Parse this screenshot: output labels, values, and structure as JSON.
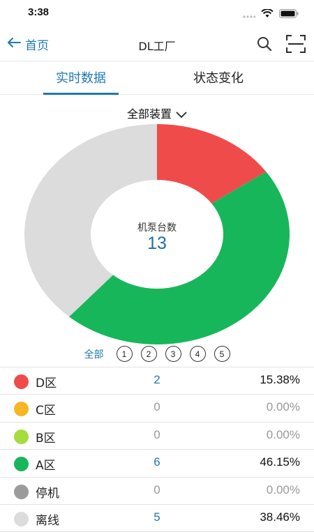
{
  "status_bar": {
    "time": "3:38"
  },
  "nav": {
    "back_label": "首页",
    "title": "DL工厂"
  },
  "tabs": [
    {
      "label": "实时数据",
      "active": true
    },
    {
      "label": "状态变化",
      "active": false
    }
  ],
  "device_filter": {
    "selected": "全部装置"
  },
  "summary": {
    "center_label": "机泵台数",
    "center_value": "13"
  },
  "pager": {
    "all_label": "全部",
    "pages": [
      "1",
      "2",
      "3",
      "4",
      "5"
    ]
  },
  "chart_data": {
    "type": "pie",
    "style": "donut",
    "categories": [
      "D区",
      "C区",
      "B区",
      "A区",
      "停机",
      "离线"
    ],
    "values": [
      2,
      0,
      0,
      6,
      0,
      5
    ],
    "colors": [
      "#f04b4b",
      "#f5b525",
      "#a6dc3e",
      "#17b65a",
      "#9b9b9b",
      "#dcdcdc"
    ]
  },
  "list": [
    {
      "name": "D区",
      "count": "2",
      "percent": "15.38%",
      "color": "#f04b4b"
    },
    {
      "name": "C区",
      "count": "0",
      "percent": "0.00%",
      "color": "#f5b525"
    },
    {
      "name": "B区",
      "count": "0",
      "percent": "0.00%",
      "color": "#a6dc3e"
    },
    {
      "name": "A区",
      "count": "6",
      "percent": "46.15%",
      "color": "#17b65a"
    },
    {
      "name": "停机",
      "count": "0",
      "percent": "0.00%",
      "color": "#9b9b9b"
    },
    {
      "name": "离线",
      "count": "5",
      "percent": "38.46%",
      "color": "#dcdcdc"
    }
  ]
}
